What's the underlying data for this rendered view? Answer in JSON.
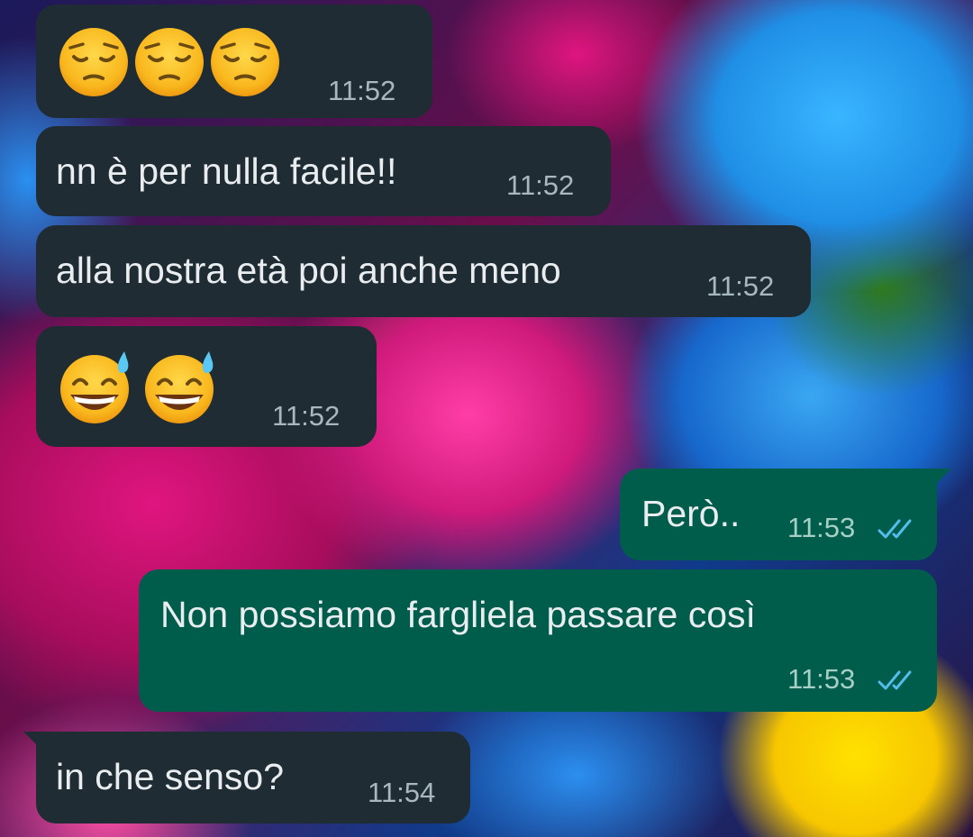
{
  "colors": {
    "incoming_bubble": "#1f2c34",
    "outgoing_bubble": "#005c4b",
    "text": "#e9edef",
    "read_ticks": "#53bdeb"
  },
  "messages": [
    {
      "direction": "incoming",
      "emoji": [
        "pensive-face-emoji",
        "pensive-face-emoji",
        "pensive-face-emoji"
      ],
      "time": "11:52"
    },
    {
      "direction": "incoming",
      "text": "nn è per nulla facile!!",
      "time": "11:52"
    },
    {
      "direction": "incoming",
      "text": "alla nostra età poi anche meno",
      "time": "11:52"
    },
    {
      "direction": "incoming",
      "emoji": [
        "grinning-sweat-emoji",
        "grinning-sweat-emoji"
      ],
      "time": "11:52"
    },
    {
      "direction": "outgoing",
      "text": "Però..",
      "time": "11:53",
      "status": "read"
    },
    {
      "direction": "outgoing",
      "text": "Non possiamo fargliela passare così",
      "time": "11:53",
      "status": "read"
    },
    {
      "direction": "incoming",
      "text": "in che senso?",
      "time": "11:54"
    }
  ]
}
